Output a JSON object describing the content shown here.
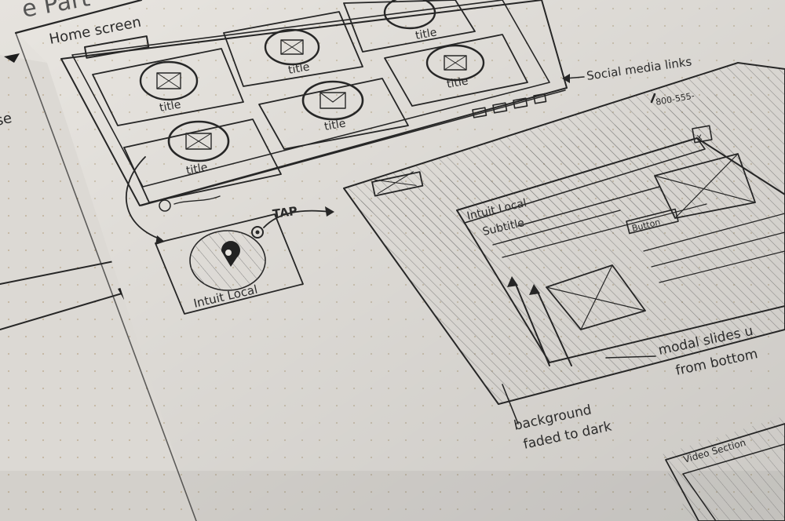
{
  "sketch": {
    "top_header": "e Part",
    "home_screen_label": "Home screen",
    "social_label": "Social media links",
    "phone_number": "800-555-",
    "left_fragment": "se",
    "tiles": [
      "title",
      "title",
      "title",
      "title",
      "title",
      "title"
    ],
    "app_icon_label": "Intuit Local",
    "tap_label": "TAP",
    "modal_title": "Intuit Local",
    "modal_subtitle": "Subtitle",
    "modal_button": "Button",
    "modal_close": "x",
    "note_modal_1": "modal slides u",
    "note_modal_2": "from bottom",
    "note_bg_1": "background",
    "note_bg_2": "faded to dark",
    "video_label": "Video Section"
  }
}
